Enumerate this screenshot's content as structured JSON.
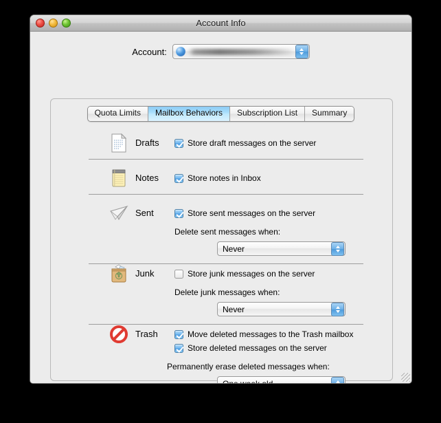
{
  "window": {
    "title": "Account Info",
    "controls": {
      "close_label": "close",
      "minimize_label": "minimize",
      "zoom_label": "zoom"
    }
  },
  "account": {
    "label": "Account:",
    "value": "",
    "icon": "globe-icon",
    "redacted": true
  },
  "tabs": [
    {
      "label": "Quota Limits",
      "selected": false
    },
    {
      "label": "Mailbox Behaviors",
      "selected": true
    },
    {
      "label": "Subscription List",
      "selected": false
    },
    {
      "label": "Summary",
      "selected": false
    }
  ],
  "sections": [
    {
      "key": "drafts",
      "title": "Drafts",
      "icon": "drafts-document-icon",
      "checkboxes": [
        {
          "label": "Store draft messages on the server",
          "checked": true
        }
      ]
    },
    {
      "key": "notes",
      "title": "Notes",
      "icon": "notes-pad-icon",
      "checkboxes": [
        {
          "label": "Store notes in Inbox",
          "checked": true
        }
      ]
    },
    {
      "key": "sent",
      "title": "Sent",
      "icon": "sent-paper-plane-icon",
      "checkboxes": [
        {
          "label": "Store sent messages on the server",
          "checked": true
        }
      ],
      "popup_label": "Delete sent messages when:",
      "popup_value": "Never"
    },
    {
      "key": "junk",
      "title": "Junk",
      "icon": "junk-bag-icon",
      "checkboxes": [
        {
          "label": "Store junk messages on the server",
          "checked": false
        }
      ],
      "popup_label": "Delete junk messages when:",
      "popup_value": "Never"
    },
    {
      "key": "trash",
      "title": "Trash",
      "icon": "trash-prohibited-icon",
      "checkboxes": [
        {
          "label": "Move deleted messages to the Trash mailbox",
          "checked": true
        },
        {
          "label": "Store deleted messages on the server",
          "checked": true
        }
      ],
      "popup_label": "Permanently erase deleted messages when:",
      "popup_value": "One week old"
    }
  ],
  "colors": {
    "selected_tab": "#a7ddfb",
    "checkbox_on": "#4b9ce2",
    "window_bg": "#ececec",
    "desktop_bg": "#000000"
  }
}
